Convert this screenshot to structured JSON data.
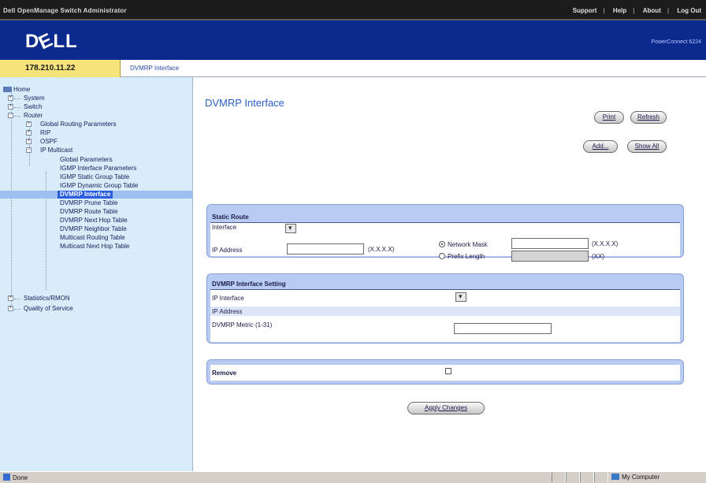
{
  "app_title": "Dell OpenManage Switch Administrator",
  "top_links": [
    "Support",
    "Help",
    "About",
    "Log Out"
  ],
  "logo": "DELL",
  "product": "PowerConnect 6224",
  "ip_address": "178.210.11.22",
  "breadcrumb": "DVMRP Interface",
  "tree": {
    "home": "Home",
    "system": "System",
    "switch": "Switch",
    "router": "Router",
    "global_routing": "Global Routing Parameters",
    "rip": "RIP",
    "ospf": "OSPF",
    "ip_multicast": "IP Multicast",
    "global_parameters": "Global Parameters",
    "igmp_interface": "IGMP Interface Parameters",
    "igmp_static": "IGMP Static Group Table",
    "igmp_dynamic": "IGMP Dynamic Group Table",
    "dvmrp_interface": "DVMRP Interface",
    "dvmrp_prune": "DVMRP Prune Table",
    "dvmrp_route": "DVMRP Route Table",
    "dvmrp_nexthop": "DVMRP Next Hop Table",
    "dvmrp_neighbor": "DVMRP Neighbor Table",
    "mcast_routing": "Multicast Routing Table",
    "mcast_nexthop": "Multicast Next Hop Table",
    "statistics": "Statistics/RMON",
    "qos": "Quality of Service"
  },
  "page_title": "DVMRP Interface",
  "buttons": {
    "print": "Print",
    "refresh": "Refresh",
    "add": "Add...",
    "show_all": "Show All",
    "apply": "Apply Changes"
  },
  "static_route": {
    "title": "Static Route",
    "interface": "Interface",
    "ip_address": "IP Address",
    "ip_hint": "(X.X.X.X)",
    "network_mask": "Network Mask",
    "mask_hint": "(X.X.X.X)",
    "prefix_length": "Prefix Length",
    "prefix_hint": "(XX)"
  },
  "dvmrp_setting": {
    "title": "DVMRP Interface Setting",
    "ip_interface": "IP Interface",
    "ip_address": "IP Address",
    "metric": "DVMRP Metric (1-31)"
  },
  "remove": {
    "label": "Remove"
  },
  "status": {
    "left": "Done",
    "zone": "My Computer"
  }
}
